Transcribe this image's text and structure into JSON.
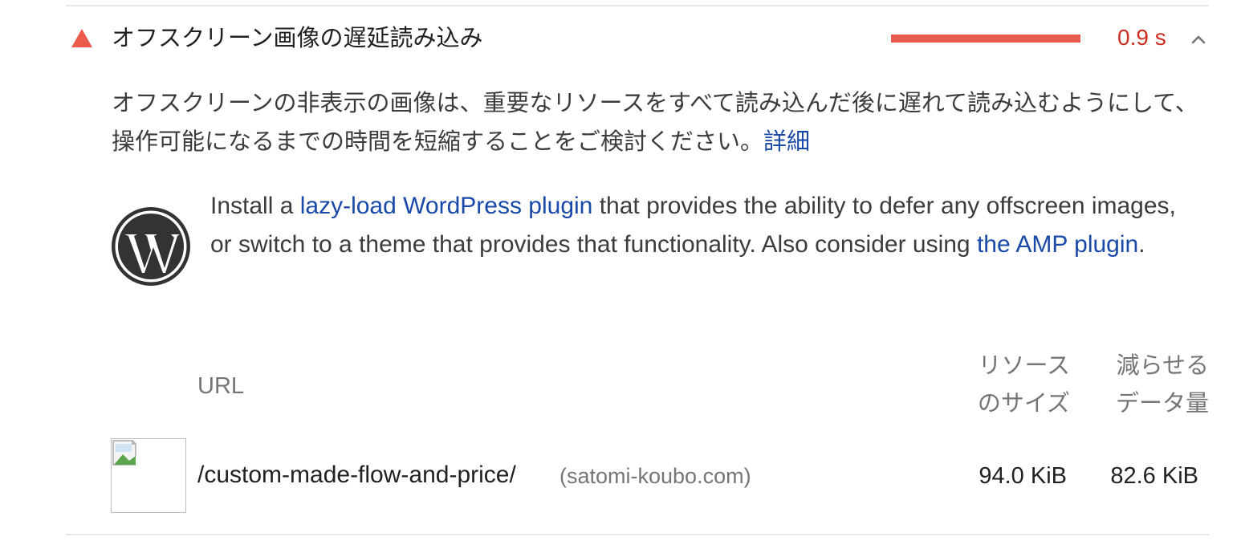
{
  "audit": {
    "title": "オフスクリーン画像の遅延読み込み",
    "savings": "0.9 s",
    "status_color": "#eb5a4b",
    "savings_text_color": "#cc2f1f",
    "icon": "warning-triangle-icon",
    "toggle_icon": "chevron-up-icon"
  },
  "description": {
    "text": "オフスクリーンの非表示の画像は、重要なリソースをすべて読み込んだ後に遅れて読み込むようにして、操作可能になるまでの時間を短縮することをご検討ください。",
    "link_label": "詳細"
  },
  "wordpress_tip": {
    "icon": "wordpress-logo-icon",
    "text_1": "Install a ",
    "link_1": "lazy-load WordPress plugin",
    "text_2": " that provides the ability to defer any offscreen images, or switch to a theme that provides that functionality. Also consider using ",
    "link_2": "the AMP plugin",
    "text_3": ".",
    "link_color": "#1a49a8"
  },
  "table": {
    "headers": {
      "url": "URL",
      "resource_size_line1": "リソース",
      "resource_size_line2": "のサイズ",
      "potential_savings_line1": "減らせる",
      "potential_savings_line2": "データ量"
    },
    "rows": [
      {
        "thumbnail_icon": "broken-image-icon",
        "url": "/custom-made-flow-and-price/",
        "host": "(satomi-koubo.com)",
        "resource_size": "94.0 KiB",
        "potential_savings": "82.6 KiB"
      }
    ]
  }
}
